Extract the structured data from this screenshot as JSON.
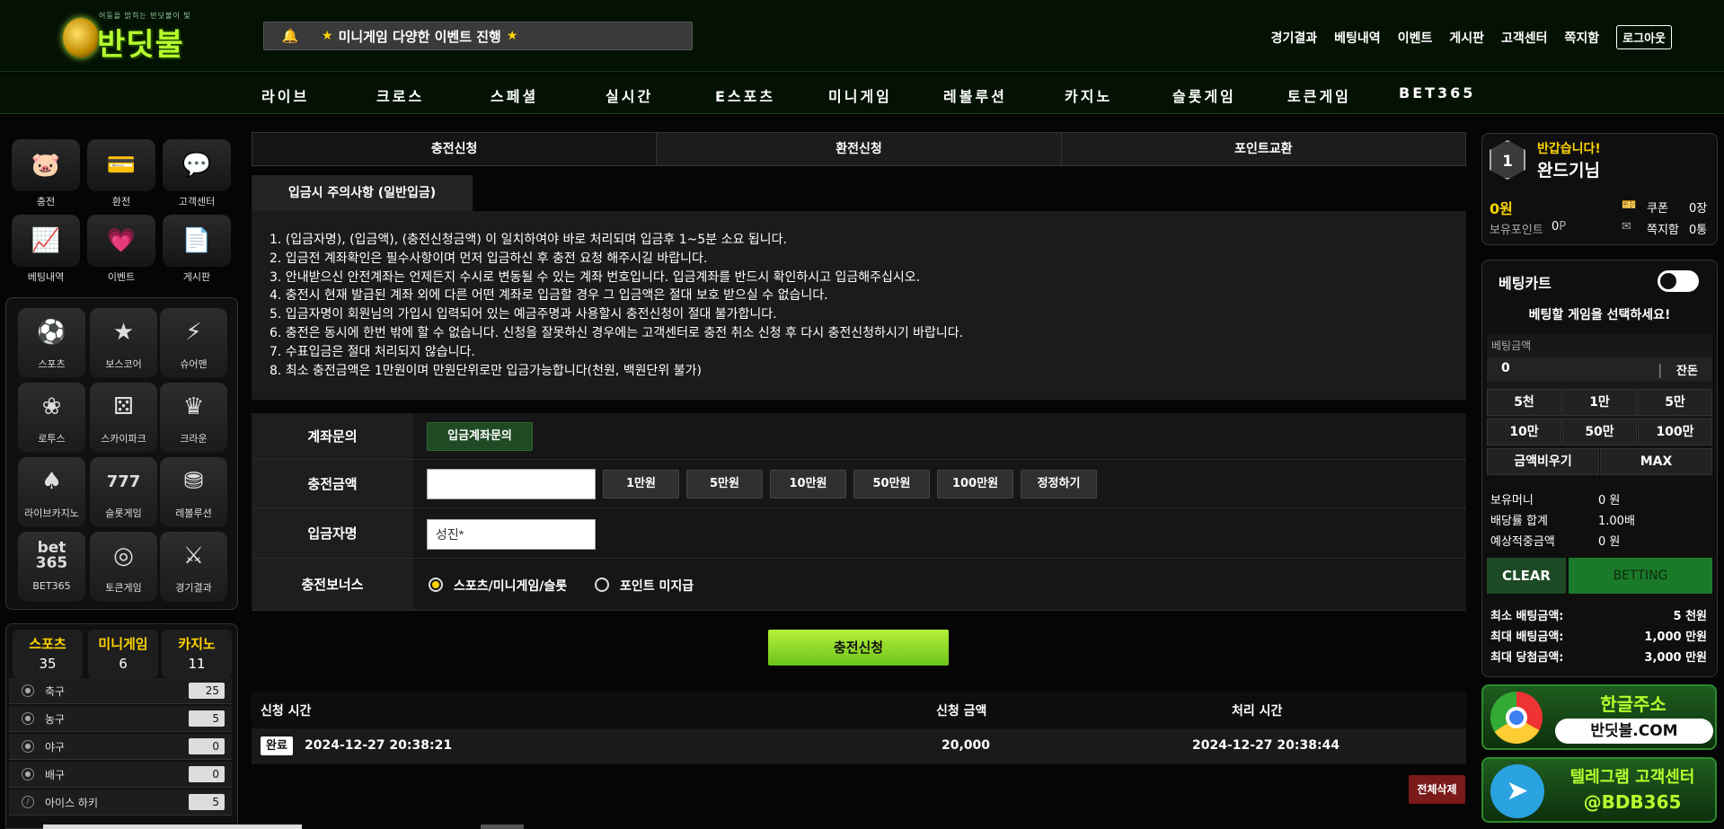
{
  "header": {
    "logo_text": "반딧불",
    "logo_tagline": "어둠을 밝히는 반딧불이 빛",
    "notice": "미니게임 다양한 이벤트 진행",
    "star": "★",
    "top_links": [
      "경기결과",
      "베팅내역",
      "이벤트",
      "게시판",
      "고객센터",
      "쪽지함"
    ],
    "logout": "로그아웃"
  },
  "main_nav": [
    "라이브",
    "크로스",
    "스페셜",
    "실시간",
    "E스포츠",
    "미니게임",
    "레볼루션",
    "카지노",
    "슬롯게임",
    "토큰게임",
    "BET365"
  ],
  "quick_menu": [
    {
      "label": "충전",
      "icon": "piggy-bank-icon"
    },
    {
      "label": "환전",
      "icon": "cards-icon"
    },
    {
      "label": "고객센터",
      "icon": "chat-icon"
    },
    {
      "label": "베팅내역",
      "icon": "chart-icon"
    },
    {
      "label": "이벤트",
      "icon": "heart-icon"
    },
    {
      "label": "게시판",
      "icon": "documents-icon"
    }
  ],
  "game_menu": [
    {
      "label": "스포츠",
      "icon": "soccer-ball-icon"
    },
    {
      "label": "보스코어",
      "icon": "star-icon"
    },
    {
      "label": "슈어맨",
      "icon": "sureman-icon"
    },
    {
      "label": "로투스",
      "icon": "lotus-icon"
    },
    {
      "label": "스카이파크",
      "icon": "dice-icon"
    },
    {
      "label": "크라운",
      "icon": "crown-icon"
    },
    {
      "label": "라이브카지노",
      "icon": "cards-spade-icon"
    },
    {
      "label": "슬롯게임",
      "icon": "slot-777-icon"
    },
    {
      "label": "레볼루션",
      "icon": "chip-icon"
    },
    {
      "label": "BET365",
      "icon": "bet365-icon",
      "icon_text1": "bet",
      "icon_text2": "365"
    },
    {
      "label": "토큰게임",
      "icon": "token-icon"
    },
    {
      "label": "경기결과",
      "icon": "vs-icon"
    }
  ],
  "counts": [
    {
      "title": "스포츠",
      "num": "35"
    },
    {
      "title": "미니게임",
      "num": "6"
    },
    {
      "title": "카지노",
      "num": "11"
    }
  ],
  "sport_list": [
    {
      "name": "축구",
      "count": "25",
      "icon": "soccer-icon"
    },
    {
      "name": "농구",
      "count": "5",
      "icon": "basketball-icon"
    },
    {
      "name": "야구",
      "count": "0",
      "icon": "baseball-icon"
    },
    {
      "name": "배구",
      "count": "0",
      "icon": "volleyball-icon"
    },
    {
      "name": "아이스 하키",
      "count": "5",
      "icon": "hockey-icon"
    }
  ],
  "tabs": [
    "충전신청",
    "환전신청",
    "포인트교환"
  ],
  "section_title": "입금시 주의사항 (일반입금)",
  "notes": [
    "1. (입금자명), (입금액), (충전신청금액) 이 일치하여야 바로 처리되며 입금후 1~5분 소요 됩니다.",
    "2. 입금전 계좌확인은 필수사항이며 먼저 입금하신 후 충전 요청 해주시길 바랍니다.",
    "3. 안내받으신 안전계좌는 언제든지 수시로 변동될 수 있는 계좌 번호입니다. 입금계좌를 반드시 확인하시고 입금해주십시오.",
    "4. 충전시 현재 발급된 계좌 외에 다른 어떤 계좌로 입금할 경우 그 입금액은 절대 보호 받으실 수 없습니다.",
    "5. 입금자명이 회원님의 가입시 입력되어 있는 예금주명과 사용할시 충전신청이 절대 불가합니다.",
    "6. 충전은 동시에 한번 밖에 할 수 없습니다. 신청을 잘못하신 경우에는 고객센터로 충전 취소 신청 후 다시 충전신청하시기 바랍니다.",
    "7. 수표입금은 절대 처리되지 않습니다.",
    "8. 최소 충전금액은 1만원이며 만원단위로만 입금가능합니다(천원, 백원단위 불가)"
  ],
  "form": {
    "account_label": "계좌문의",
    "account_btn": "입금계좌문의",
    "amount_label": "충전금액",
    "amount_value": "",
    "amount_btns": [
      "1만원",
      "5만원",
      "10만원",
      "50만원",
      "100만원",
      "정정하기"
    ],
    "depositor_label": "입금자명",
    "depositor_value": "성진*",
    "bonus_label": "충전보너스",
    "bonus_options": [
      "스포츠/미니게임/슬롯",
      "포인트 미지급"
    ],
    "submit": "충전신청"
  },
  "history": {
    "headers": [
      "신청 시간",
      "신청 금액",
      "처리 시간"
    ],
    "rows": [
      {
        "status": "완료",
        "requested": "2024-12-27 20:38:21",
        "amount": "20,000",
        "processed": "2024-12-27 20:38:44"
      }
    ],
    "delete_all": "전체삭제"
  },
  "user": {
    "level": "1",
    "greeting": "반갑습니다!",
    "name": "완드기님",
    "money": "0원",
    "points_label": "보유포인트",
    "points": "0",
    "points_unit": "P",
    "coupon_label": "쿠폰",
    "coupon_count": "0장",
    "message_label": "쪽지함",
    "message_count": "0통"
  },
  "betslip": {
    "title": "베팅카트",
    "prompt": "베팅할 게임을 선택하세요!",
    "amount_label": "베팅금액",
    "amount_value": "0",
    "change_label": "잔돈",
    "quick_amounts": [
      "5천",
      "1만",
      "5만",
      "10만",
      "50만",
      "100만"
    ],
    "clear_amount": "금액비우기",
    "max": "MAX",
    "money_label": "보유머니",
    "money_value": "0 원",
    "odds_label": "배당률 합계",
    "odds_value": "1.00배",
    "expected_label": "예상적중금액",
    "expected_value": "0 원",
    "clear": "CLEAR",
    "betting": "BETTING",
    "min_bet_label": "최소 배팅금액:",
    "min_bet": "5 천원",
    "max_bet_label": "최대 배팅금액:",
    "max_bet": "1,000 만원",
    "max_win_label": "최대 당첨금액:",
    "max_win": "3,000 만원"
  },
  "banners": [
    {
      "title": "한글주소",
      "sub": "반딧불.COM",
      "icon": "chrome-icon"
    },
    {
      "title": "텔레그램 고객센터",
      "sub": "@BDB365",
      "icon": "telegram-icon"
    }
  ],
  "colors": {
    "accent": "#b6ff2e",
    "yellow": "#ffd400",
    "submit": "#8ed82a",
    "betting": "#1a7a2a",
    "delete": "#7a1a1a"
  }
}
